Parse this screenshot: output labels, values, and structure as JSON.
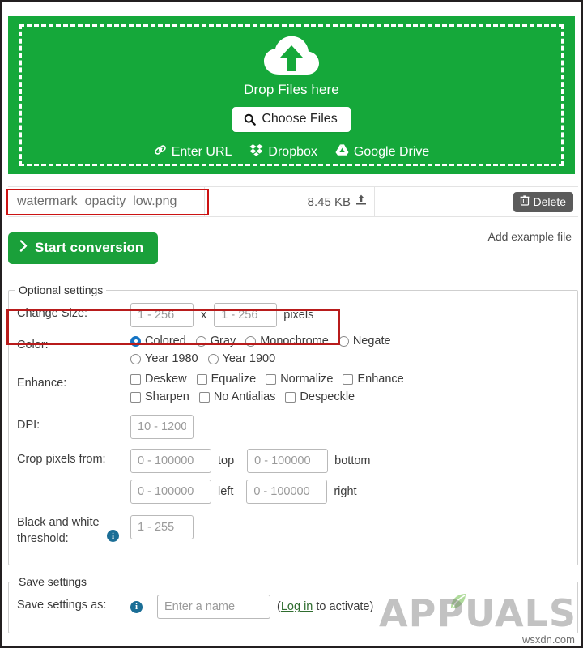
{
  "dropzone": {
    "icon": "cloud-upload-icon",
    "title": "Drop Files here",
    "choose_button": "Choose Files",
    "choose_icon": "search-icon",
    "links": [
      {
        "label": "Enter URL",
        "icon": "link-icon"
      },
      {
        "label": "Dropbox",
        "icon": "dropbox-icon"
      },
      {
        "label": "Google Drive",
        "icon": "google-drive-icon"
      }
    ]
  },
  "file_row": {
    "name": "watermark_opacity_low.png",
    "size": "8.45 KB",
    "upload_icon": "upload-icon",
    "delete_label": "Delete",
    "delete_icon": "trash-icon"
  },
  "actions": {
    "start_conversion": "Start conversion",
    "start_icon": "chevron-right-icon",
    "add_example_file": "Add example file"
  },
  "optional_settings": {
    "legend": "Optional settings",
    "change_size": {
      "label": "Change Size:",
      "width_placeholder": "1 - 256",
      "width_value": "",
      "separator": "x",
      "height_placeholder": "1 - 256",
      "height_value": "",
      "unit": "pixels"
    },
    "color": {
      "label": "Color:",
      "options": [
        {
          "label": "Colored",
          "selected": true
        },
        {
          "label": "Gray",
          "selected": false
        },
        {
          "label": "Monochrome",
          "selected": false
        },
        {
          "label": "Negate",
          "selected": false
        },
        {
          "label": "Year 1980",
          "selected": false
        },
        {
          "label": "Year 1900",
          "selected": false
        }
      ]
    },
    "enhance": {
      "label": "Enhance:",
      "options": [
        {
          "label": "Deskew",
          "checked": false
        },
        {
          "label": "Equalize",
          "checked": false
        },
        {
          "label": "Normalize",
          "checked": false
        },
        {
          "label": "Enhance",
          "checked": false
        },
        {
          "label": "Sharpen",
          "checked": false
        },
        {
          "label": "No Antialias",
          "checked": false
        },
        {
          "label": "Despeckle",
          "checked": false
        }
      ]
    },
    "dpi": {
      "label": "DPI:",
      "placeholder": "10 - 1200",
      "value": ""
    },
    "crop": {
      "label": "Crop pixels from:",
      "placeholder": "0 - 100000",
      "top_label": "top",
      "bottom_label": "bottom",
      "left_label": "left",
      "right_label": "right",
      "top_value": "",
      "bottom_value": "",
      "left_value": "",
      "right_value": ""
    },
    "bw_threshold": {
      "label": "Black and white threshold:",
      "info_icon": "info-icon",
      "placeholder": "1 - 255",
      "value": ""
    }
  },
  "save_settings": {
    "legend": "Save settings",
    "label": "Save settings as:",
    "info_icon": "info-icon",
    "placeholder": "Enter a name",
    "value": "",
    "note_open": "(",
    "login_link": "Log in",
    "note_rest": " to activate)"
  },
  "watermarks": {
    "brand": "APPUALS",
    "site": "wsxdn.com"
  },
  "colors": {
    "dropzone_green": "#15a83a",
    "button_green": "#1aa03a",
    "highlight_red": "#b81b1b",
    "radio_blue": "#1474c4",
    "delete_gray": "#5b5b5b",
    "info_blue": "#1b6e96"
  }
}
